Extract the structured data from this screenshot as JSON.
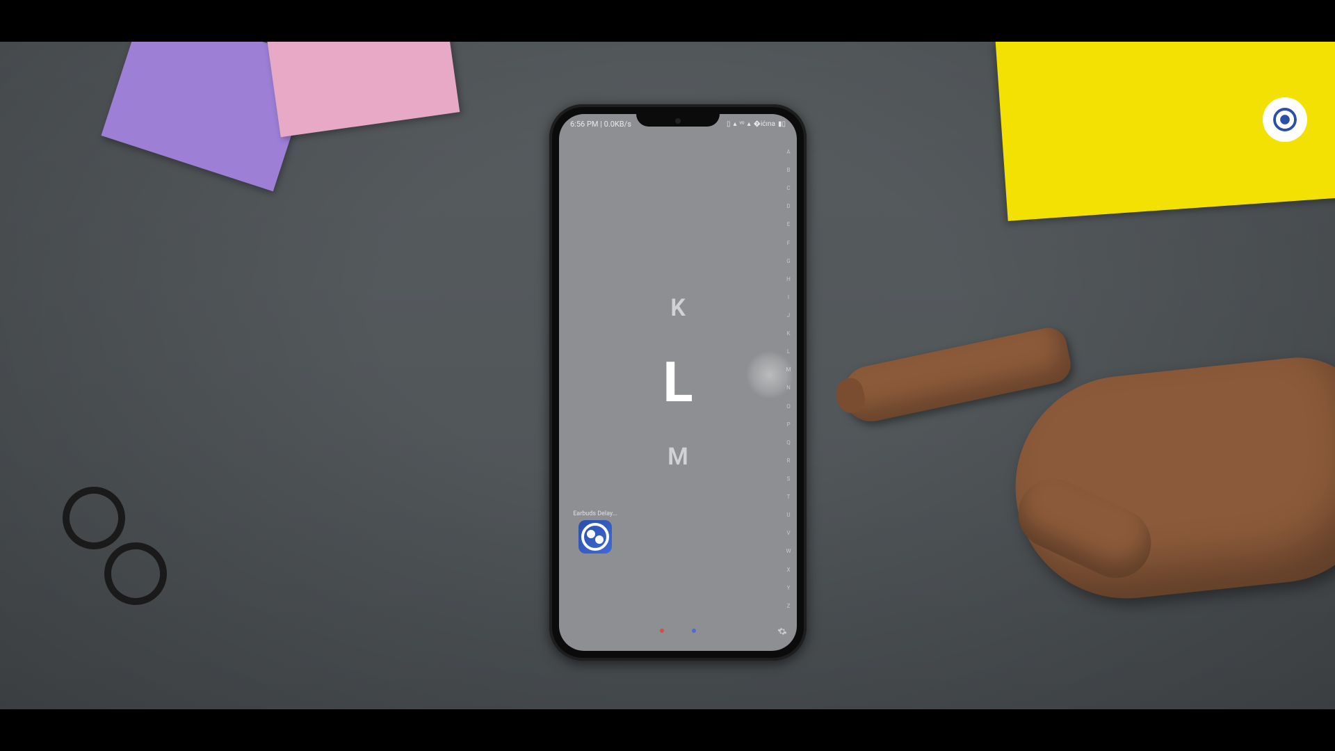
{
  "status_bar": {
    "time": "6:56 PM",
    "net_speed": "0.0KB/s",
    "separator": " | "
  },
  "alpha_scroll": {
    "prev": "K",
    "current": "L",
    "next": "M"
  },
  "alpha_index": [
    "A",
    "B",
    "C",
    "D",
    "E",
    "F",
    "G",
    "H",
    "I",
    "J",
    "K",
    "L",
    "M",
    "N",
    "O",
    "P",
    "Q",
    "R",
    "S",
    "T",
    "U",
    "V",
    "W",
    "X",
    "Y",
    "Z"
  ],
  "app": {
    "label": "Earbuds Delay...",
    "icon_name": "earbuds-delay-icon"
  },
  "pagination": {
    "count": 2,
    "active": 1
  }
}
